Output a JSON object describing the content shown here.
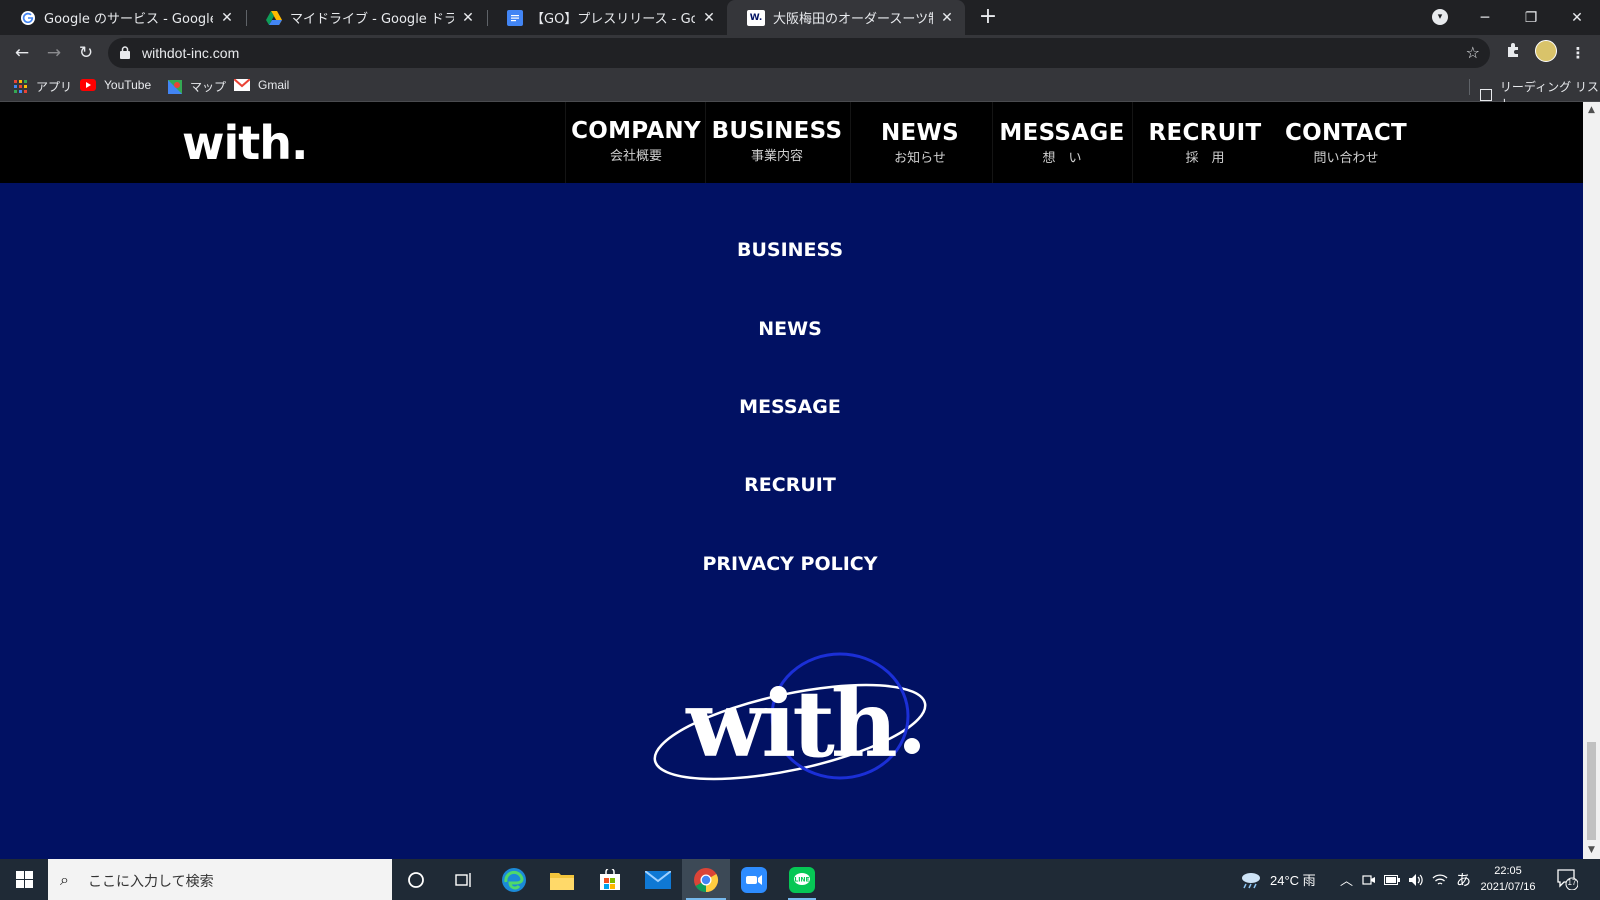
{
  "browser": {
    "tabs": [
      {
        "title": "Google のサービス - Google",
        "icon": "google-g-icon"
      },
      {
        "title": "マイドライブ - Google ドライブ",
        "icon": "google-drive-icon"
      },
      {
        "title": "【GO】プレスリリース - Google ドキュメ",
        "icon": "google-docs-icon"
      },
      {
        "title": "大阪梅田のオーダースーツ制作や営業",
        "icon": "with-favicon",
        "active": true
      }
    ],
    "favicon_letter": "W.",
    "url": "withdot-inc.com",
    "bookmarks": [
      {
        "label": "アプリ",
        "icon": "apps-grid-icon"
      },
      {
        "label": "YouTube",
        "icon": "youtube-icon"
      },
      {
        "label": "マップ",
        "icon": "maps-icon"
      },
      {
        "label": "Gmail",
        "icon": "gmail-icon"
      }
    ],
    "reading_list": "リーディング リスト"
  },
  "site": {
    "logo": "with.",
    "nav": [
      {
        "en": "COMPANY",
        "ja": "会社概要"
      },
      {
        "en": "BUSINESS",
        "ja": "事業内容"
      },
      {
        "en": "NEWS",
        "ja": "お知らせ"
      },
      {
        "en": "MESSAGE",
        "ja": "想　い"
      },
      {
        "en": "RECRUIT",
        "ja": "採　用"
      },
      {
        "en": "CONTACT",
        "ja": "問い合わせ"
      }
    ],
    "footer_links": [
      "BUSINESS",
      "NEWS",
      "MESSAGE",
      "RECRUIT",
      "PRIVACY POLICY"
    ],
    "footer_logo": "with",
    "colors": {
      "header_bg": "#000000",
      "footer_bg": "#011163",
      "logo_ring": "#1b2fd6"
    }
  },
  "taskbar": {
    "search_placeholder": "ここに入力して検索",
    "weather": "24°C 雨",
    "ime": "あ",
    "time": "22:05",
    "date": "2021/07/16",
    "notifications": "17"
  }
}
